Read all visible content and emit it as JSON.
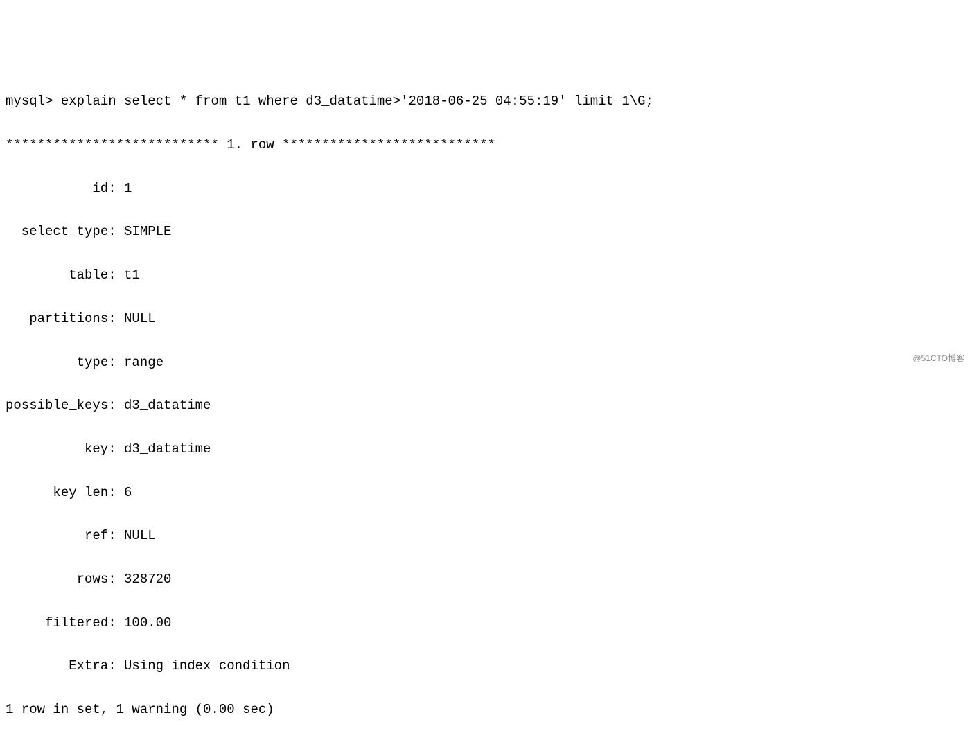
{
  "prompt": "mysql> ",
  "query": "explain select * from t1 where d3_datatime>'2018-06-25 04:55:19' limit 1\\G;",
  "row_separator_left": "*************************** ",
  "row_separator_label": "1. row",
  "row_separator_right": " ***************************",
  "explain": {
    "fields": [
      {
        "label": "id",
        "value": "1"
      },
      {
        "label": "select_type",
        "value": "SIMPLE"
      },
      {
        "label": "table",
        "value": "t1"
      },
      {
        "label": "partitions",
        "value": "NULL"
      },
      {
        "label": "type",
        "value": "range"
      },
      {
        "label": "possible_keys",
        "value": "d3_datatime"
      },
      {
        "label": "key",
        "value": "d3_datatime"
      },
      {
        "label": "key_len",
        "value": "6"
      },
      {
        "label": "ref",
        "value": "NULL"
      },
      {
        "label": "rows",
        "value": "328720"
      },
      {
        "label": "filtered",
        "value": "100.00"
      },
      {
        "label": "Extra",
        "value": "Using index condition"
      }
    ]
  },
  "footer": "1 row in set, 1 warning (0.00 sec)",
  "watermark": "@51CTO博客"
}
